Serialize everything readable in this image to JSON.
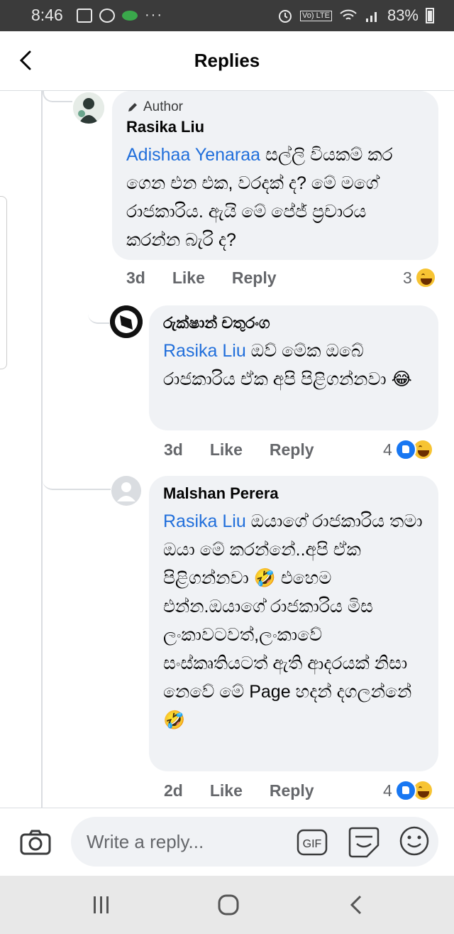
{
  "status_bar": {
    "time": "8:46",
    "battery": "83%",
    "network": "Vo) LTE"
  },
  "header": {
    "title": "Replies"
  },
  "comments": [
    {
      "author_badge": "Author",
      "name": "Rasika Liu",
      "mention": "Adishaa Yenaraa",
      "text": " සල්ලි වියකම් කර ගෙන එන එක, වරදක් ද? මේ මගේ රාජකාරිය. ඇයි මේ පේජ් ප්‍රචාරය කරන්න බැරි ද?",
      "time": "3d",
      "like_label": "Like",
      "reply_label": "Reply",
      "reaction_count": "3",
      "reactions": [
        "haha"
      ]
    },
    {
      "name": "රුක්ෂාන් චතුරංග",
      "mention": "Rasika Liu",
      "text": " ඔව් මේක ඔබේ රාජකාරිය ඒක අපි පිළිගන්නවා 😂",
      "time": "3d",
      "like_label": "Like",
      "reply_label": "Reply",
      "reaction_count": "4",
      "reactions": [
        "like",
        "haha"
      ]
    },
    {
      "name": "Malshan Perera",
      "mention": "Rasika Liu",
      "text": " ඔයාගේ රාජකාරිය තමා ඔයා මේ කරන්නේ..අපි ඒක පිළිගන්නවා 🤣 එහෙම එන්න.ඔයාගේ රාජකාරිය මිස ලංකාවටවත්,ලංකාවේ සංස්කෘතියටත් ඇති ආදරයක් නිසා නෙවේ මේ Page හදන් දගලන්නේ 🤣",
      "time": "2d",
      "like_label": "Like",
      "reply_label": "Reply",
      "reaction_count": "4",
      "reactions": [
        "like",
        "haha"
      ]
    }
  ],
  "composer": {
    "placeholder": "Write a reply...",
    "gif_label": "GIF"
  },
  "icons": {
    "back": "back-arrow-icon",
    "camera": "camera-icon",
    "gif": "gif-icon",
    "sticker": "sticker-icon",
    "emoji": "emoji-icon",
    "nav": [
      "recent-apps-icon",
      "home-icon",
      "nav-back-icon"
    ]
  },
  "colors": {
    "mention": "#216fdb",
    "bubble": "#f0f2f5",
    "like_blue": "#1877f2",
    "haha_yellow": "#f7c433"
  }
}
